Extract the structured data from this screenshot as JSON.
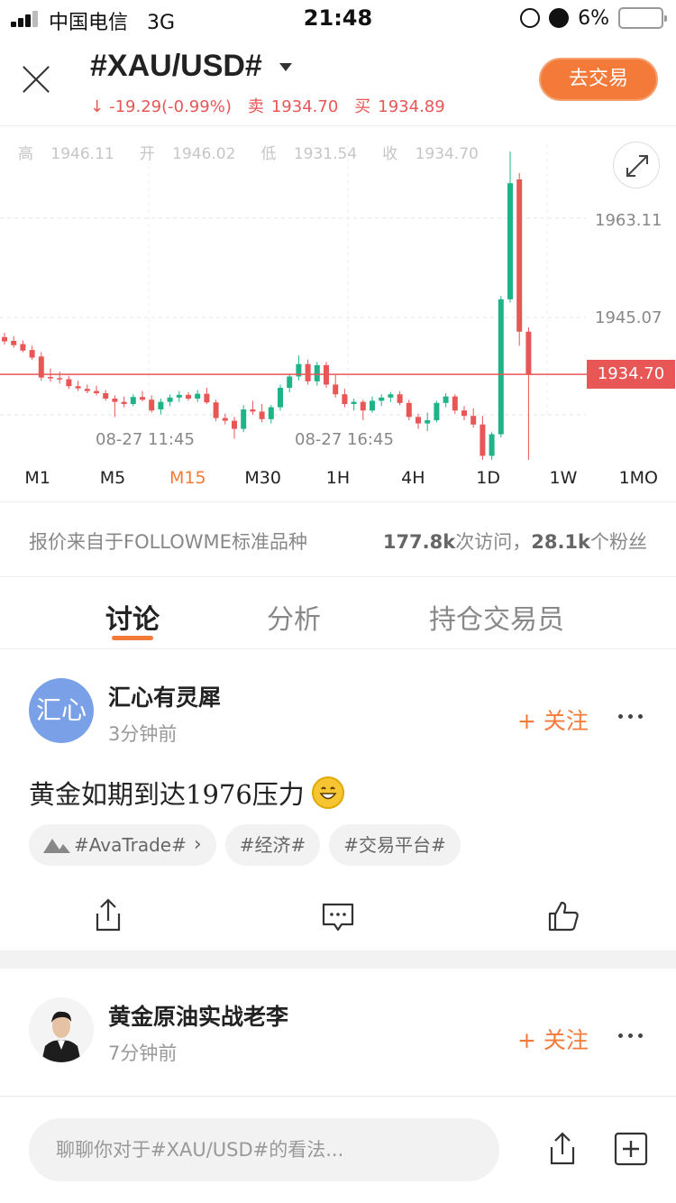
{
  "status_bar": {
    "carrier": "中国电信",
    "network": "3G",
    "time": "21:48",
    "battery": "6%"
  },
  "header": {
    "symbol": "#XAU/USD#",
    "change_arrow": "↓",
    "change": "-19.29(-0.99%)",
    "sell_label": "卖",
    "sell_price": "1934.70",
    "buy_label": "买",
    "buy_price": "1934.89",
    "trade_button": "去交易"
  },
  "chart": {
    "ohlc": {
      "high_label": "高",
      "high": "1946.11",
      "open_label": "开",
      "open": "1946.02",
      "low_label": "低",
      "low": "1931.54",
      "close_label": "收",
      "close": "1934.70"
    },
    "y_labels": [
      "1963.11",
      "1945.07"
    ],
    "current_price": "1934.70",
    "x_labels": [
      "08-27 11:45",
      "08-27 16:45"
    ],
    "up_color": "#1fb388",
    "down_color": "#e85656"
  },
  "chart_data": {
    "type": "candlestick",
    "current_price": 1934.7,
    "y_ticks": [
      1963.11,
      1945.07
    ],
    "candles": [
      {
        "o": 1941.6,
        "h": 1942.4,
        "l": 1940.2,
        "c": 1940.8
      },
      {
        "o": 1940.9,
        "h": 1941.8,
        "l": 1939.6,
        "c": 1940.1
      },
      {
        "o": 1940.3,
        "h": 1941.0,
        "l": 1938.8,
        "c": 1939.1
      },
      {
        "o": 1939.2,
        "h": 1940.0,
        "l": 1937.4,
        "c": 1937.8
      },
      {
        "o": 1938.0,
        "h": 1938.8,
        "l": 1933.5,
        "c": 1934.1
      },
      {
        "o": 1934.2,
        "h": 1935.8,
        "l": 1933.3,
        "c": 1934.0
      },
      {
        "o": 1934.0,
        "h": 1935.2,
        "l": 1933.0,
        "c": 1933.8
      },
      {
        "o": 1933.8,
        "h": 1934.4,
        "l": 1932.0,
        "c": 1932.5
      },
      {
        "o": 1932.5,
        "h": 1933.5,
        "l": 1931.6,
        "c": 1932.1
      },
      {
        "o": 1932.0,
        "h": 1932.8,
        "l": 1931.2,
        "c": 1931.6
      },
      {
        "o": 1931.6,
        "h": 1932.6,
        "l": 1930.8,
        "c": 1931.2
      },
      {
        "o": 1931.2,
        "h": 1931.8,
        "l": 1929.8,
        "c": 1930.2
      },
      {
        "o": 1930.2,
        "h": 1930.8,
        "l": 1926.8,
        "c": 1929.6
      },
      {
        "o": 1929.6,
        "h": 1930.6,
        "l": 1928.6,
        "c": 1929.2
      },
      {
        "o": 1929.2,
        "h": 1931.0,
        "l": 1928.8,
        "c": 1930.5
      },
      {
        "o": 1930.5,
        "h": 1931.6,
        "l": 1929.7,
        "c": 1930.0
      },
      {
        "o": 1930.0,
        "h": 1930.8,
        "l": 1927.6,
        "c": 1928.0
      },
      {
        "o": 1928.2,
        "h": 1930.2,
        "l": 1927.3,
        "c": 1929.6
      },
      {
        "o": 1929.6,
        "h": 1931.0,
        "l": 1928.8,
        "c": 1930.4
      },
      {
        "o": 1930.4,
        "h": 1931.6,
        "l": 1929.6,
        "c": 1930.9
      },
      {
        "o": 1930.9,
        "h": 1931.4,
        "l": 1929.8,
        "c": 1930.2
      },
      {
        "o": 1930.2,
        "h": 1931.8,
        "l": 1929.6,
        "c": 1931.1
      },
      {
        "o": 1931.1,
        "h": 1932.2,
        "l": 1929.2,
        "c": 1929.5
      },
      {
        "o": 1929.5,
        "h": 1930.0,
        "l": 1926.0,
        "c": 1926.6
      },
      {
        "o": 1926.6,
        "h": 1927.4,
        "l": 1925.4,
        "c": 1926.1
      },
      {
        "o": 1926.1,
        "h": 1926.8,
        "l": 1922.8,
        "c": 1924.6
      },
      {
        "o": 1924.6,
        "h": 1929.0,
        "l": 1924.0,
        "c": 1928.2
      },
      {
        "o": 1928.2,
        "h": 1929.8,
        "l": 1927.2,
        "c": 1927.8
      },
      {
        "o": 1927.8,
        "h": 1929.2,
        "l": 1925.8,
        "c": 1926.4
      },
      {
        "o": 1926.4,
        "h": 1929.0,
        "l": 1925.6,
        "c": 1928.6
      },
      {
        "o": 1928.6,
        "h": 1932.8,
        "l": 1928.0,
        "c": 1932.2
      },
      {
        "o": 1932.2,
        "h": 1934.8,
        "l": 1931.4,
        "c": 1934.3
      },
      {
        "o": 1934.3,
        "h": 1938.2,
        "l": 1933.6,
        "c": 1936.6
      },
      {
        "o": 1936.6,
        "h": 1937.4,
        "l": 1932.8,
        "c": 1933.4
      },
      {
        "o": 1933.4,
        "h": 1937.0,
        "l": 1932.6,
        "c": 1936.4
      },
      {
        "o": 1936.4,
        "h": 1937.0,
        "l": 1932.2,
        "c": 1932.8
      },
      {
        "o": 1932.8,
        "h": 1934.6,
        "l": 1930.4,
        "c": 1931.0
      },
      {
        "o": 1931.0,
        "h": 1932.0,
        "l": 1928.6,
        "c": 1929.2
      },
      {
        "o": 1929.2,
        "h": 1930.2,
        "l": 1928.0,
        "c": 1929.6
      },
      {
        "o": 1929.6,
        "h": 1930.0,
        "l": 1926.2,
        "c": 1928.0
      },
      {
        "o": 1928.0,
        "h": 1930.6,
        "l": 1927.6,
        "c": 1929.8
      },
      {
        "o": 1929.8,
        "h": 1931.0,
        "l": 1928.8,
        "c": 1930.4
      },
      {
        "o": 1930.4,
        "h": 1931.4,
        "l": 1929.6,
        "c": 1931.0
      },
      {
        "o": 1931.0,
        "h": 1931.6,
        "l": 1929.0,
        "c": 1929.4
      },
      {
        "o": 1929.4,
        "h": 1930.0,
        "l": 1926.2,
        "c": 1926.8
      },
      {
        "o": 1926.8,
        "h": 1927.4,
        "l": 1924.6,
        "c": 1925.6
      },
      {
        "o": 1925.6,
        "h": 1927.6,
        "l": 1924.2,
        "c": 1926.2
      },
      {
        "o": 1926.2,
        "h": 1929.8,
        "l": 1925.8,
        "c": 1929.4
      },
      {
        "o": 1929.4,
        "h": 1931.2,
        "l": 1928.6,
        "c": 1930.6
      },
      {
        "o": 1930.6,
        "h": 1931.0,
        "l": 1927.4,
        "c": 1928.0
      },
      {
        "o": 1928.0,
        "h": 1928.8,
        "l": 1926.2,
        "c": 1927.0
      },
      {
        "o": 1927.0,
        "h": 1928.4,
        "l": 1924.8,
        "c": 1925.4
      },
      {
        "o": 1925.4,
        "h": 1927.0,
        "l": 1917.5,
        "c": 1919.6
      },
      {
        "o": 1919.6,
        "h": 1924.0,
        "l": 1918.4,
        "c": 1923.6
      },
      {
        "o": 1923.6,
        "h": 1949.2,
        "l": 1923.0,
        "c": 1948.6
      },
      {
        "o": 1948.6,
        "h": 1976.0,
        "l": 1948.0,
        "c": 1970.1
      },
      {
        "o": 1970.8,
        "h": 1972.0,
        "l": 1940.0,
        "c": 1942.6
      },
      {
        "o": 1942.6,
        "h": 1943.4,
        "l": 1916.4,
        "c": 1934.7
      }
    ]
  },
  "timeframes": [
    {
      "label": "M1",
      "active": false
    },
    {
      "label": "M5",
      "active": false
    },
    {
      "label": "M15",
      "active": true
    },
    {
      "label": "M30",
      "active": false
    },
    {
      "label": "1H",
      "active": false
    },
    {
      "label": "4H",
      "active": false
    },
    {
      "label": "1D",
      "active": false
    },
    {
      "label": "1W",
      "active": false
    },
    {
      "label": "1MO",
      "active": false
    }
  ],
  "info": {
    "source": "报价来自于FOLLOWME标准品种",
    "visits_count": "177.8k",
    "visits_label": "次访问，",
    "fans_count": "28.1k",
    "fans_label": "个粉丝"
  },
  "tabs": [
    "讨论",
    "分析",
    "持仓交易员"
  ],
  "posts": [
    {
      "avatar_text": "汇心",
      "author": "汇心有灵犀",
      "time": "3分钟前",
      "follow": "+ 关注",
      "text": "黄金如期到达1976压力",
      "tags": [
        "#AvaTrade#",
        "#经济#",
        "#交易平台#"
      ]
    },
    {
      "author": "黄金原油实战老李",
      "time": "7分钟前",
      "follow": "+ 关注"
    }
  ],
  "bottom": {
    "placeholder": "聊聊你对于#XAU/USD#的看法..."
  }
}
